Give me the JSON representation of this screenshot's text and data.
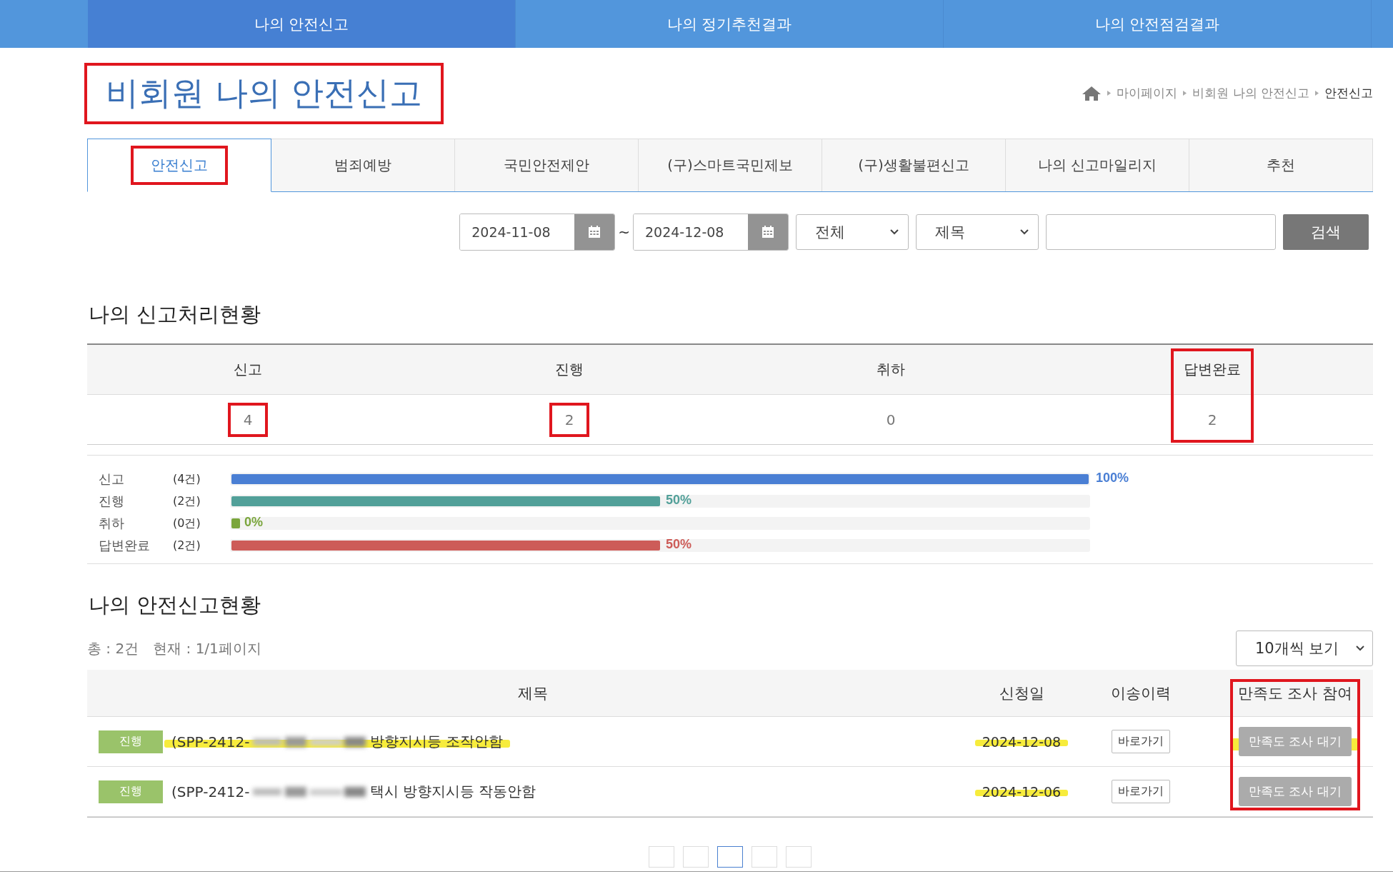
{
  "nav": [
    {
      "label": "나의 안전신고",
      "selected": true
    },
    {
      "label": "나의 정기추천결과",
      "selected": false
    },
    {
      "label": "나의 안전점검결과",
      "selected": false
    }
  ],
  "page_title": {
    "text": "비회원 나의 안전신고",
    "marked": true
  },
  "breadcrumb": [
    "마이페이지",
    "비회원 나의 안전신고",
    "안전신고"
  ],
  "tabs": [
    {
      "label": "안전신고",
      "selected": true,
      "marked": true
    },
    {
      "label": "범죄예방",
      "selected": false,
      "marked": false
    },
    {
      "label": "국민안전제안",
      "selected": false,
      "marked": false
    },
    {
      "label": "(구)스마트국민제보",
      "selected": false,
      "marked": false
    },
    {
      "label": "(구)생활불편신고",
      "selected": false,
      "marked": false
    },
    {
      "label": "나의 신고마일리지",
      "selected": false,
      "marked": false
    },
    {
      "label": "추천",
      "selected": false,
      "marked": false
    }
  ],
  "filters": {
    "date_from": "2024-11-08",
    "separator": "~",
    "date_to": "2024-12-08",
    "status_select": "전체",
    "field_select": "제목",
    "search_button": "검색"
  },
  "summary": {
    "title": "나의 신고처리현황",
    "columns": [
      {
        "label": "신고",
        "value": "4",
        "header_marked": false,
        "value_marked": true
      },
      {
        "label": "진행",
        "value": "2",
        "header_marked": false,
        "value_marked": true
      },
      {
        "label": "취하",
        "value": "0",
        "header_marked": false,
        "value_marked": false
      },
      {
        "label": "답변완료",
        "value": "2",
        "header_marked": true,
        "value_marked": true
      }
    ]
  },
  "progress": [
    {
      "label": "신고",
      "count": "(4건)",
      "level": 1,
      "percent": "100%",
      "color": "#4a7fd4"
    },
    {
      "label": "진행",
      "count": "(2건)",
      "level": 0.5,
      "percent": "50%",
      "color": "#52a099"
    },
    {
      "label": "취하",
      "count": "(0건)",
      "level": 0,
      "percent": "0%",
      "color": "#7aa53c"
    },
    {
      "label": "답변완료",
      "count": "(2건)",
      "level": 0.5,
      "percent": "50%",
      "color": "#cd5c58"
    }
  ],
  "list": {
    "title": "나의 안전신고현황",
    "total": "총 : 2건",
    "page_info": "현재 : 1/1페이지",
    "page_size": "10개씩 보기",
    "columns": [
      {
        "label": "제목",
        "annotated": false
      },
      {
        "label": "신청일",
        "annotated": false
      },
      {
        "label": "이송이력",
        "annotated": false
      },
      {
        "label": "만족도 조사 참여",
        "annotated": true
      }
    ],
    "rows": [
      {
        "status": "진행",
        "title_prefix": "(SPP-2412-",
        "title_suffix": "방향지시등 조작안함",
        "date": "2024-12-08",
        "transfer": "바로가기",
        "survey": "만족도 조사 대기",
        "survey_disabled": true,
        "title_highlighted": true,
        "date_highlighted": true,
        "survey_highlighted": true
      },
      {
        "status": "진행",
        "title_prefix": "(SPP-2412-",
        "title_suffix": "택시 방향지시등 작동안함",
        "date": "2024-12-06",
        "transfer": "바로가기",
        "survey": "만족도 조사 대기",
        "survey_disabled": true,
        "title_highlighted": false,
        "date_highlighted": true,
        "survey_highlighted": false
      }
    ]
  },
  "pagination": [
    {
      "selected": false
    },
    {
      "selected": false
    },
    {
      "selected": true
    },
    {
      "selected": false
    },
    {
      "selected": false
    }
  ]
}
